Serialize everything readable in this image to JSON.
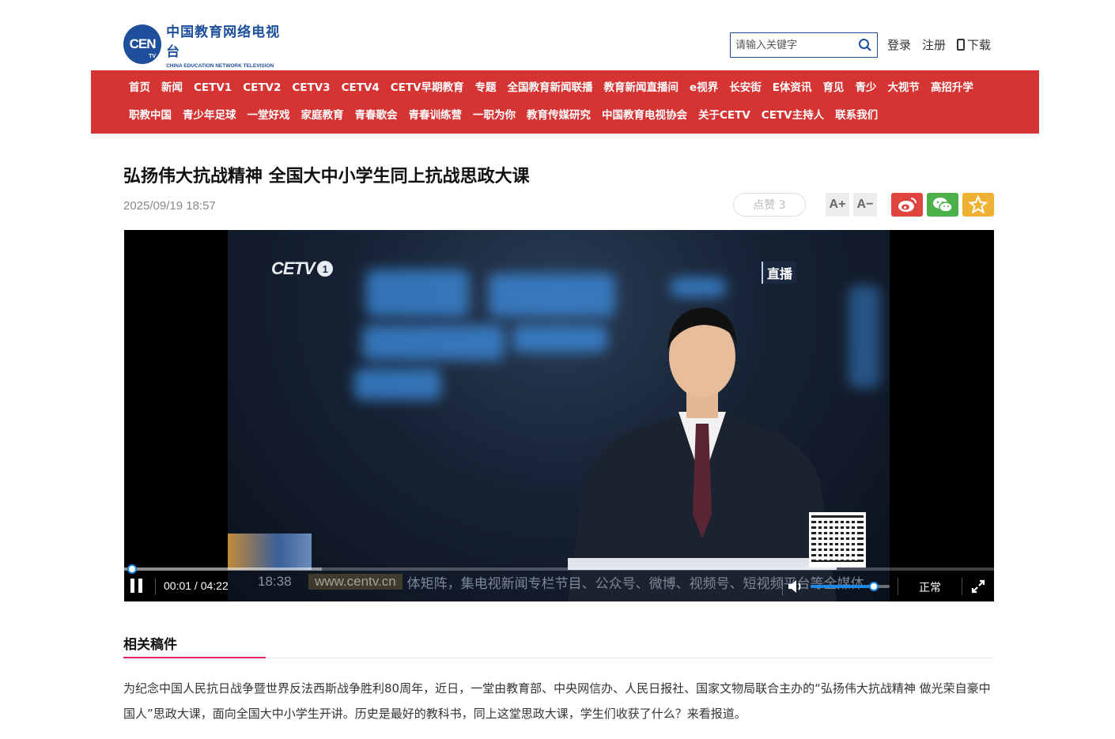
{
  "header": {
    "logo": {
      "abbr": "CEN",
      "tv": "TV",
      "cn_name": "中国教育网络电视台",
      "en_name": "CHINA EDUCATION NETWORK TELEVISION"
    },
    "search": {
      "placeholder": "请输入关键字",
      "value": ""
    },
    "links": {
      "login": "登录",
      "register": "注册",
      "download": "下载"
    }
  },
  "nav": {
    "row1": [
      "首页",
      "新闻",
      "CETV1",
      "CETV2",
      "CETV3",
      "CETV4",
      "CETV早期教育",
      "专题",
      "全国教育新闻联播",
      "教育新闻直播间",
      "e视界",
      "长安街",
      "E体资讯",
      "育见",
      "青少",
      "大视节",
      "高招升学"
    ],
    "row2": [
      "职教中国",
      "青少年足球",
      "一堂好戏",
      "家庭教育",
      "青春歌会",
      "青春训练营",
      "一职为你",
      "教育传媒研究",
      "中国教育电视协会",
      "关于CETV",
      "CETV主持人",
      "联系我们"
    ]
  },
  "article": {
    "title": "弘扬伟大抗战精神 全国大中小学生同上抗战思政大课",
    "date": "2025/09/19 18:57",
    "like_label": "点赞 3",
    "font_increase": "A+",
    "font_decrease": "A−"
  },
  "video": {
    "channel_logo": "CETV",
    "channel_number": "1",
    "live_tag": "直播",
    "ticker_time": "18:38",
    "ticker_site": "www.centv.cn",
    "ticker_text": "体矩阵，集电视新闻专栏节目、公众号、微博、视频号、短视频平台等全媒体",
    "current_time": "00:01",
    "duration": "04:22",
    "time_display": "00:01 / 04:22",
    "progress_fraction": 0.004,
    "buffered_fraction": 0.227,
    "volume_fraction": 0.8,
    "speed_label": "正常"
  },
  "related": {
    "heading": "相关稿件",
    "body": "为纪念中国人民抗日战争暨世界反法西斯战争胜利80周年，近日，一堂由教育部、中央网信办、人民日报社、国家文物局联合主办的“弘扬伟大抗战精神  做光荣自豪中国人”思政大课，面向全国大中小学生开讲。历史是最好的教科书，同上这堂思政大课，学生们收获了什么？来看报道。"
  },
  "colors": {
    "brand_blue": "#1d4f9c",
    "nav_red": "#d63333",
    "accent_pink": "#e0245e",
    "weibo_red": "#e0443e",
    "wechat_green": "#4cb04a",
    "favorite_yellow": "#efb133",
    "player_blue": "#1e88e5"
  },
  "icons": {
    "search": "search-icon",
    "phone": "phone-icon",
    "weibo": "weibo-icon",
    "wechat": "wechat-icon",
    "favorite": "star-icon",
    "pause": "pause-icon",
    "volume": "volume-icon",
    "fullscreen": "fullscreen-icon"
  }
}
